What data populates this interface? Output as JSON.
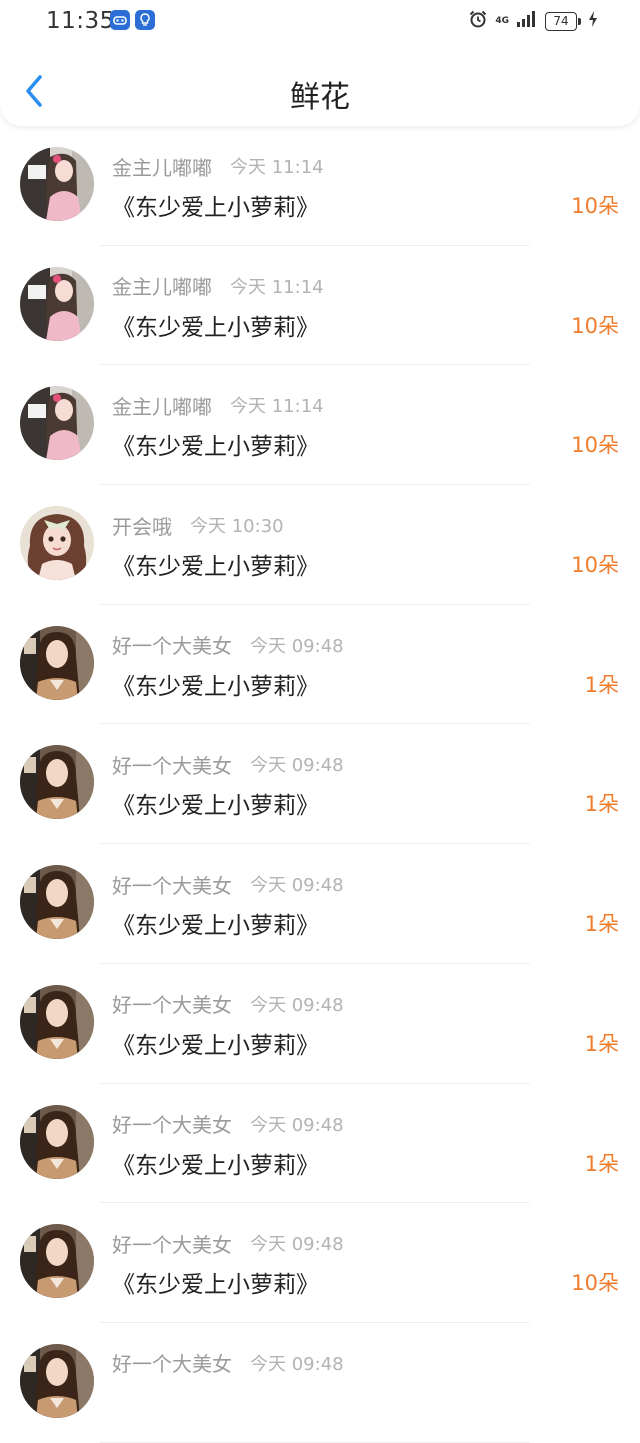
{
  "status_bar": {
    "time": "11:35",
    "network": "4G",
    "battery": "74",
    "icons": [
      "game-controller-icon",
      "lightbulb-icon",
      "alarm-icon",
      "signal-icon",
      "battery-icon",
      "charging-icon"
    ]
  },
  "header": {
    "title": "鲜花",
    "back_icon": "chevron-left-icon",
    "accent_color": "#2a8df0"
  },
  "colors": {
    "count": "#f07c2c",
    "name": "#9a9a9a",
    "time": "#b3b3b3"
  },
  "items": [
    {
      "user": "金主儿嘟嘟",
      "time": "今天 11:14",
      "book": "《东少爱上小萝莉》",
      "count": "10朵",
      "avatar": "pink-girl"
    },
    {
      "user": "金主儿嘟嘟",
      "time": "今天 11:14",
      "book": "《东少爱上小萝莉》",
      "count": "10朵",
      "avatar": "pink-girl"
    },
    {
      "user": "金主儿嘟嘟",
      "time": "今天 11:14",
      "book": "《东少爱上小萝莉》",
      "count": "10朵",
      "avatar": "pink-girl"
    },
    {
      "user": "开会哦",
      "time": "今天 10:30",
      "book": "《东少爱上小萝莉》",
      "count": "10朵",
      "avatar": "curly-girl"
    },
    {
      "user": "好一个大美女",
      "time": "今天 09:48",
      "book": "《东少爱上小萝莉》",
      "count": "1朵",
      "avatar": "long-hair"
    },
    {
      "user": "好一个大美女",
      "time": "今天 09:48",
      "book": "《东少爱上小萝莉》",
      "count": "1朵",
      "avatar": "long-hair"
    },
    {
      "user": "好一个大美女",
      "time": "今天 09:48",
      "book": "《东少爱上小萝莉》",
      "count": "1朵",
      "avatar": "long-hair"
    },
    {
      "user": "好一个大美女",
      "time": "今天 09:48",
      "book": "《东少爱上小萝莉》",
      "count": "1朵",
      "avatar": "long-hair"
    },
    {
      "user": "好一个大美女",
      "time": "今天 09:48",
      "book": "《东少爱上小萝莉》",
      "count": "1朵",
      "avatar": "long-hair"
    },
    {
      "user": "好一个大美女",
      "time": "今天 09:48",
      "book": "《东少爱上小萝莉》",
      "count": "10朵",
      "avatar": "long-hair"
    },
    {
      "user": "好一个大美女",
      "time": "今天 09:48",
      "book": "",
      "count": "",
      "avatar": "long-hair"
    }
  ]
}
